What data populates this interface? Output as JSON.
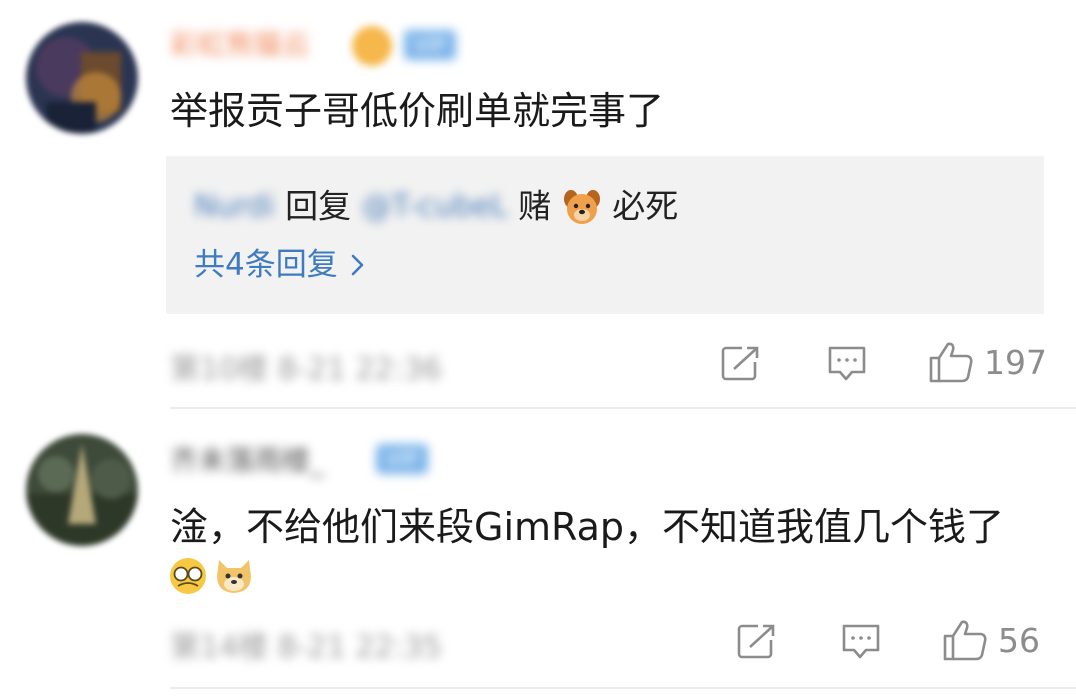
{
  "comments": [
    {
      "username": "彩虹熊猫云",
      "vip_label": "VIP",
      "content": "举报贡子哥低价刷单就完事了",
      "reply": {
        "from": "Nurdi",
        "verb": "回复",
        "to": "@T-cubeL",
        "text_before": "赌",
        "text_after": " 必死",
        "emoji": "dog-face-icon"
      },
      "more_replies": "共4条回复 ",
      "meta": "第10楼 8-21 22:36",
      "likes": "197"
    },
    {
      "username": "齐未落雨楼_",
      "vip_label": "VIP",
      "content": "淦，不给他们来段GimRap，不知道我值几个钱了",
      "emojis": [
        "facepalm-glasses-icon",
        "doge-icon"
      ],
      "meta": "第14楼 8-21 22:35",
      "likes": "56"
    }
  ],
  "colors": {
    "link": "#3f7bc0",
    "vip": "#7cb4ea",
    "username": "#f08a5d",
    "reply_bg": "#f2f2f2",
    "meta": "#999999"
  }
}
